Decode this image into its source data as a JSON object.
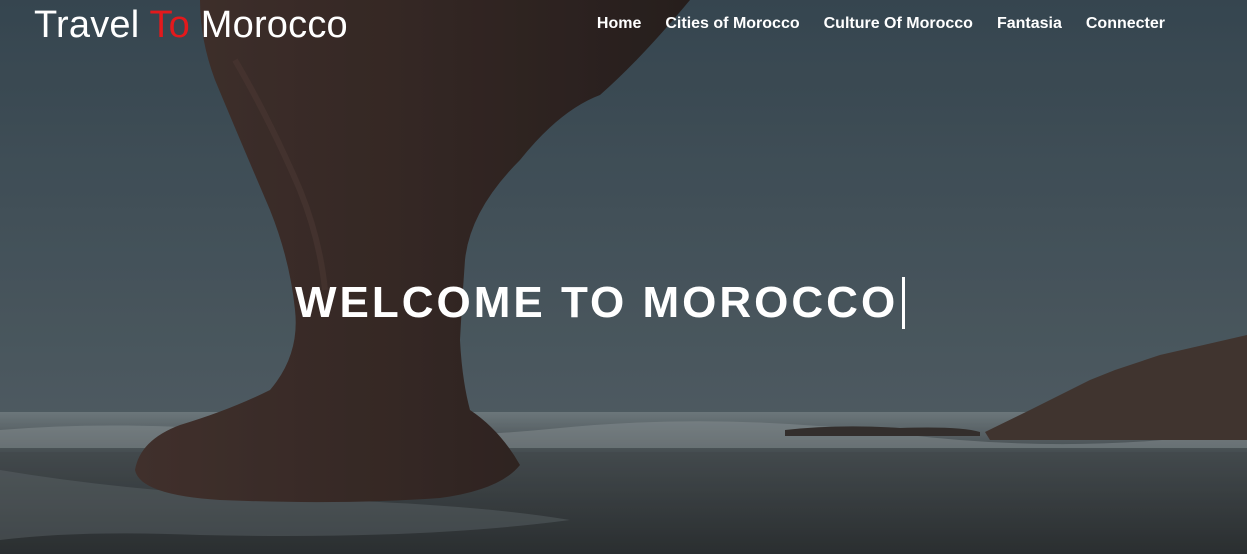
{
  "brand": {
    "part1": "Travel",
    "part2": "To",
    "part3": "Morocco",
    "accent_color": "#e3191c"
  },
  "nav": {
    "items": [
      {
        "label": "Home"
      },
      {
        "label": "Cities of Morocco"
      },
      {
        "label": "Culture Of Morocco"
      },
      {
        "label": "Fantasia"
      },
      {
        "label": "Connecter"
      }
    ]
  },
  "hero": {
    "headline": "WELCOME TO MOROCCO",
    "background": "legzira-beach-rock-arch"
  }
}
